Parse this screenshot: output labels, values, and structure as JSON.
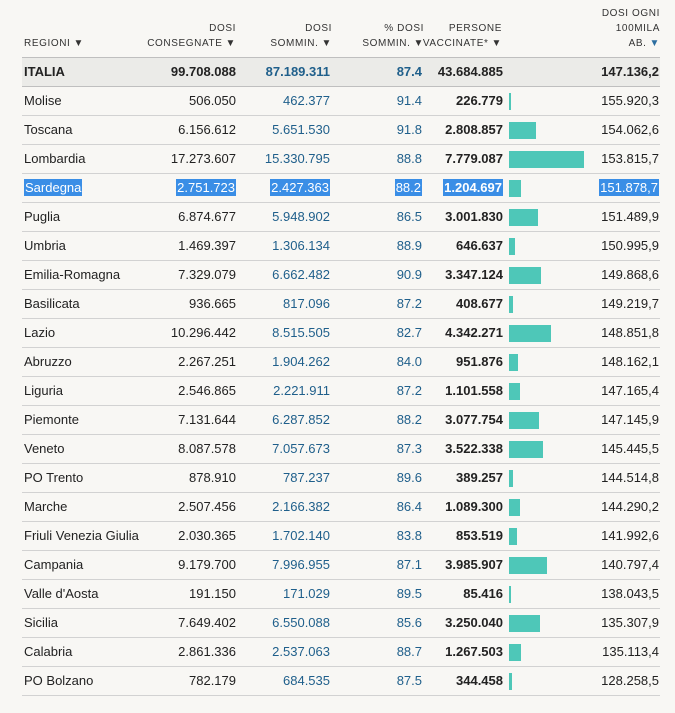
{
  "header": {
    "region": "REGIONI",
    "consegnate_line1": "DOSI",
    "consegnate_line2": "CONSEGNATE",
    "somm_line1": "DOSI",
    "somm_line2": "SOMMIN.",
    "pct_line1": "% DOSI",
    "pct_line2": "SOMMIN.",
    "persone_line1": "PERSONE",
    "persone_line2": "VACCINATE*",
    "dosi100_line1": "DOSI OGNI",
    "dosi100_line2": "100MILA",
    "dosi100_line3": "AB.",
    "sort_arrow": "▼"
  },
  "colors": {
    "bar": "#4ec7b8",
    "accent": "#1f5f8b",
    "highlight": "#3a8ee6"
  },
  "total": {
    "region": "ITALIA",
    "consegnate": "99.708.088",
    "somministrate": "87.189.311",
    "pct": "87.4",
    "persone": "43.684.885",
    "dosi100": "147.136,2"
  },
  "rows": [
    {
      "region": "Molise",
      "consegnate": "506.050",
      "somministrate": "462.377",
      "pct": "91.4",
      "persone": "226.779",
      "persone_num": 226779,
      "dosi100": "155.920,3"
    },
    {
      "region": "Toscana",
      "consegnate": "6.156.612",
      "somministrate": "5.651.530",
      "pct": "91.8",
      "persone": "2.808.857",
      "persone_num": 2808857,
      "dosi100": "154.062,6"
    },
    {
      "region": "Lombardia",
      "consegnate": "17.273.607",
      "somministrate": "15.330.795",
      "pct": "88.8",
      "persone": "7.779.087",
      "persone_num": 7779087,
      "dosi100": "153.815,7"
    },
    {
      "region": "Sardegna",
      "consegnate": "2.751.723",
      "somministrate": "2.427.363",
      "pct": "88.2",
      "persone": "1.204.697",
      "persone_num": 1204697,
      "dosi100": "151.878,7",
      "selected": true
    },
    {
      "region": "Puglia",
      "consegnate": "6.874.677",
      "somministrate": "5.948.902",
      "pct": "86.5",
      "persone": "3.001.830",
      "persone_num": 3001830,
      "dosi100": "151.489,9"
    },
    {
      "region": "Umbria",
      "consegnate": "1.469.397",
      "somministrate": "1.306.134",
      "pct": "88.9",
      "persone": "646.637",
      "persone_num": 646637,
      "dosi100": "150.995,9"
    },
    {
      "region": "Emilia-Romagna",
      "consegnate": "7.329.079",
      "somministrate": "6.662.482",
      "pct": "90.9",
      "persone": "3.347.124",
      "persone_num": 3347124,
      "dosi100": "149.868,6"
    },
    {
      "region": "Basilicata",
      "consegnate": "936.665",
      "somministrate": "817.096",
      "pct": "87.2",
      "persone": "408.677",
      "persone_num": 408677,
      "dosi100": "149.219,7"
    },
    {
      "region": "Lazio",
      "consegnate": "10.296.442",
      "somministrate": "8.515.505",
      "pct": "82.7",
      "persone": "4.342.271",
      "persone_num": 4342271,
      "dosi100": "148.851,8"
    },
    {
      "region": "Abruzzo",
      "consegnate": "2.267.251",
      "somministrate": "1.904.262",
      "pct": "84.0",
      "persone": "951.876",
      "persone_num": 951876,
      "dosi100": "148.162,1"
    },
    {
      "region": "Liguria",
      "consegnate": "2.546.865",
      "somministrate": "2.221.911",
      "pct": "87.2",
      "persone": "1.101.558",
      "persone_num": 1101558,
      "dosi100": "147.165,4"
    },
    {
      "region": "Piemonte",
      "consegnate": "7.131.644",
      "somministrate": "6.287.852",
      "pct": "88.2",
      "persone": "3.077.754",
      "persone_num": 3077754,
      "dosi100": "147.145,9"
    },
    {
      "region": "Veneto",
      "consegnate": "8.087.578",
      "somministrate": "7.057.673",
      "pct": "87.3",
      "persone": "3.522.338",
      "persone_num": 3522338,
      "dosi100": "145.445,5"
    },
    {
      "region": "PO Trento",
      "consegnate": "878.910",
      "somministrate": "787.237",
      "pct": "89.6",
      "persone": "389.257",
      "persone_num": 389257,
      "dosi100": "144.514,8"
    },
    {
      "region": "Marche",
      "consegnate": "2.507.456",
      "somministrate": "2.166.382",
      "pct": "86.4",
      "persone": "1.089.300",
      "persone_num": 1089300,
      "dosi100": "144.290,2"
    },
    {
      "region": "Friuli Venezia Giulia",
      "consegnate": "2.030.365",
      "somministrate": "1.702.140",
      "pct": "83.8",
      "persone": "853.519",
      "persone_num": 853519,
      "dosi100": "141.992,6"
    },
    {
      "region": "Campania",
      "consegnate": "9.179.700",
      "somministrate": "7.996.955",
      "pct": "87.1",
      "persone": "3.985.907",
      "persone_num": 3985907,
      "dosi100": "140.797,4"
    },
    {
      "region": "Valle d'Aosta",
      "consegnate": "191.150",
      "somministrate": "171.029",
      "pct": "89.5",
      "persone": "85.416",
      "persone_num": 85416,
      "dosi100": "138.043,5"
    },
    {
      "region": "Sicilia",
      "consegnate": "7.649.402",
      "somministrate": "6.550.088",
      "pct": "85.6",
      "persone": "3.250.040",
      "persone_num": 3250040,
      "dosi100": "135.307,9"
    },
    {
      "region": "Calabria",
      "consegnate": "2.861.336",
      "somministrate": "2.537.063",
      "pct": "88.7",
      "persone": "1.267.503",
      "persone_num": 1267503,
      "dosi100": "135.113,4"
    },
    {
      "region": "PO Bolzano",
      "consegnate": "782.179",
      "somministrate": "684.535",
      "pct": "87.5",
      "persone": "344.458",
      "persone_num": 344458,
      "dosi100": "128.258,5"
    }
  ]
}
